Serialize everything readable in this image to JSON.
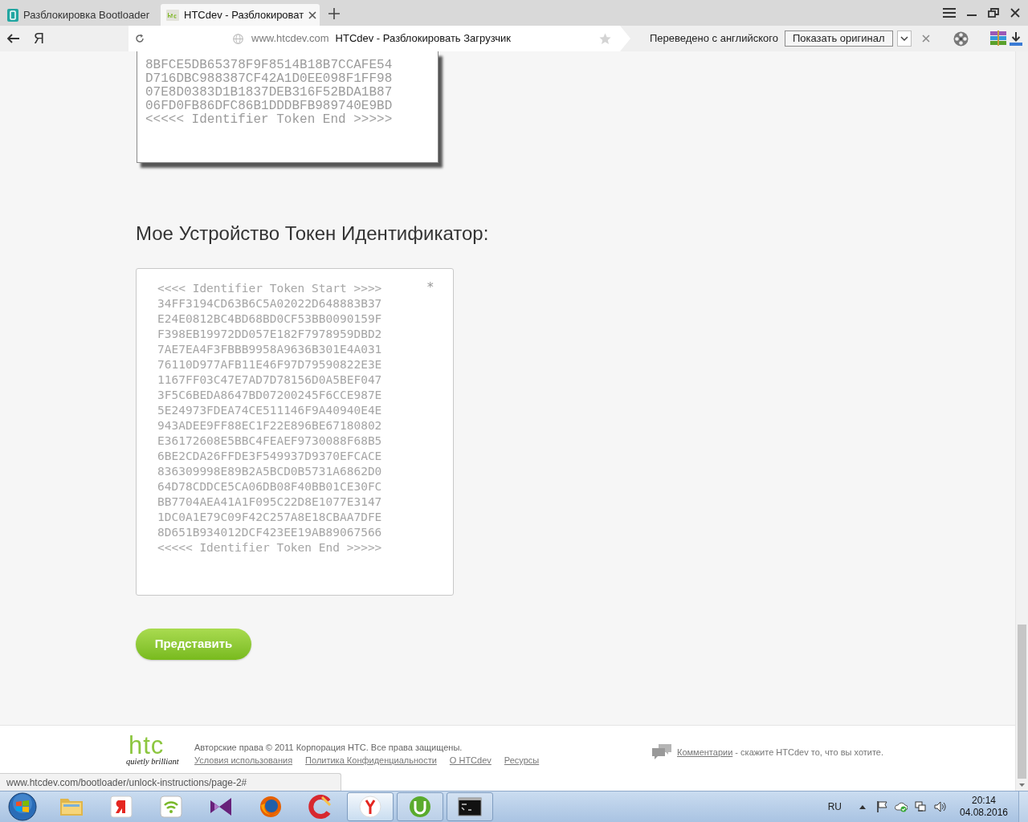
{
  "browser": {
    "tabs": [
      {
        "title": "Разблокировка Bootloader",
        "kind": "phone",
        "selected": false
      },
      {
        "title": "HTCdev - Разблокироват",
        "kind": "site",
        "selected": true
      }
    ],
    "logo_button": "Я",
    "address": {
      "domain": "www.htcdev.com",
      "title": "HTCdev - Разблокировать Загрузчик"
    },
    "translation_bar": {
      "message": "Переведено с английского",
      "button": "Показать оригинал"
    }
  },
  "page": {
    "token_example": {
      "lines": [
        "8BFCE5DB65378F9F8514B18B7CCAFE54",
        "D716DBC988387CF42A1D0EE098F1FF98",
        "07E8D0383D1B1837DEB316F52BDA1B87",
        "06FD0FB86DFC86B1DDDBFB989740E9BD",
        "<<<<< Identifier Token End >>>>>"
      ]
    },
    "heading": "Мое Устройство Токен Идентификатор:",
    "token_field": {
      "value_lines": [
        "<<<< Identifier Token Start >>>>",
        "34FF3194CD63B6C5A02022D648883B37",
        "E24E0812BC4BD68BD0CF53BB0090159F",
        "F398EB19972DD057E182F7978959DBD2",
        "7AE7EA4F3FBBB9958A9636B301E4A031",
        "76110D977AFB11E46F97D79590822E3E",
        "1167FF03C47E7AD7D78156D0A5BEF047",
        "3F5C6BEDA8647BD07200245F6CCE987E",
        "5E24973FDEA74CE511146F9A40940E4E",
        "943ADEE9FF88EC1F22E896BE67180802",
        "E36172608E5BBC4FEAEF9730088F68B5",
        "6BE2CDA26FFDE3F549937D9370EFCACE",
        "836309998E89B2A5BCD0B5731A6862D0",
        "64D78CDDCE5CA06DB08F40BB01CE30FC",
        "BB7704AEA41A1F095C22D8E1077E3147",
        "1DC0A1E79C09F42C257A8E18CBAA7DFE",
        "8D651B934012DCF423EE19AB89067566",
        "<<<<< Identifier Token End >>>>>"
      ],
      "marker": "*"
    },
    "submit_button": "Представить",
    "footer": {
      "logo": {
        "wordmark": "htc",
        "tagline": "quietly brilliant"
      },
      "copyright": "Авторские права © 2011 Корпорация HTC. Все права защищены.",
      "links": [
        "Условия использования",
        "Политика Конфиденциальности",
        "О HTCdev",
        "Ресурсы"
      ],
      "feedback": {
        "link": "Комментарии",
        "text": "- скажите HTCdev то, что вы хотите."
      }
    }
  },
  "status_url": "www.htcdev.com/bootloader/unlock-instructions/page-2#",
  "taskbar": {
    "apps": [
      {
        "kind": "folder",
        "running": false,
        "selected": false
      },
      {
        "kind": "tile",
        "running": false,
        "selected": false
      },
      {
        "kind": "wifi",
        "running": false,
        "selected": false
      },
      {
        "kind": "bowtie",
        "running": false,
        "selected": false
      },
      {
        "kind": "globe",
        "running": false,
        "selected": false
      },
      {
        "kind": "arc",
        "running": false,
        "selected": false
      },
      {
        "kind": "circle-y",
        "running": true,
        "selected": true
      },
      {
        "kind": "circle-hook",
        "running": true,
        "selected": false
      },
      {
        "kind": "terminal",
        "running": true,
        "selected": false
      }
    ],
    "language": "RU",
    "time": "20:14",
    "date": "04.08.2016"
  }
}
